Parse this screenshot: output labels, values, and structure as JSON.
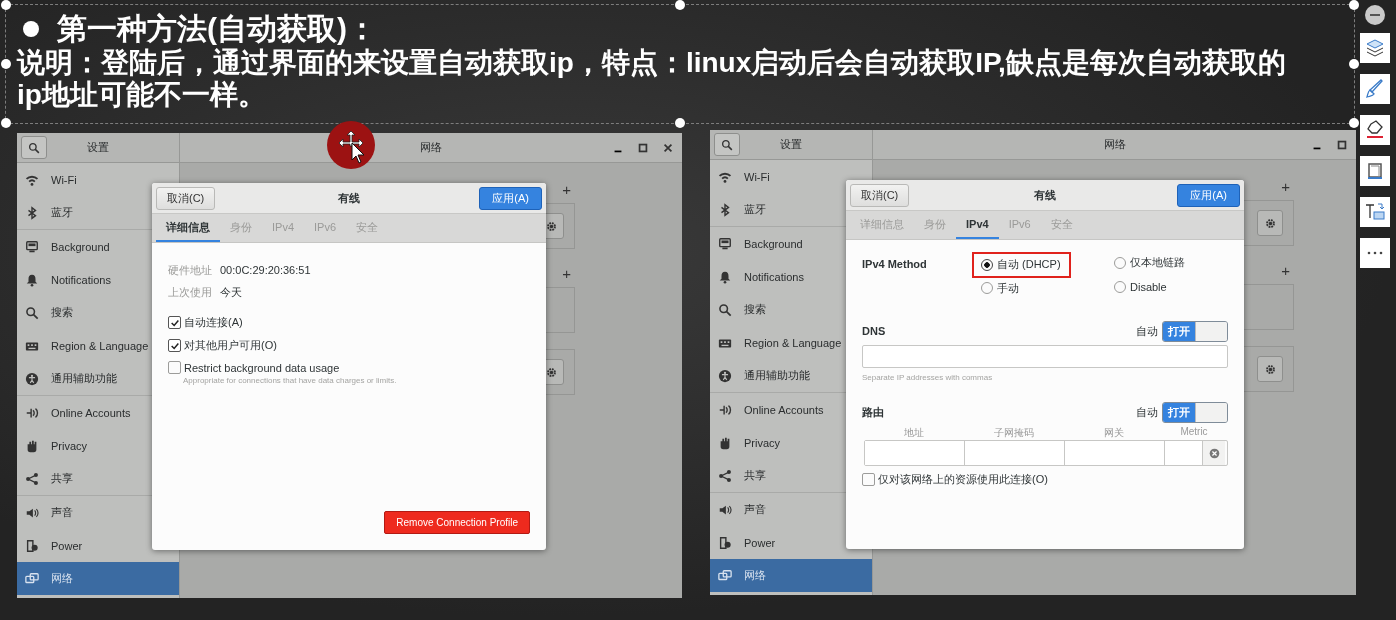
{
  "slide": {
    "title": "第一种方法(自动获取)：",
    "description": "说明：登陆后，通过界面的来设置自动获取ip，特点：linux启动后会自动获取IP,缺点是每次自动获取的ip地址可能不一样。"
  },
  "windows": [
    {
      "header": "设置",
      "page_title": "网络",
      "close_button": true,
      "add_buttons": [
        "+",
        "+"
      ],
      "sidebar": {
        "groups": [
          [
            {
              "label": "Wi-Fi",
              "selected": false
            },
            {
              "label": "蓝牙",
              "selected": false
            }
          ],
          [
            {
              "label": "Background",
              "selected": false
            },
            {
              "label": "Notifications",
              "selected": false
            },
            {
              "label": "搜索",
              "selected": false
            },
            {
              "label": "Region & Language",
              "selected": false
            },
            {
              "label": "通用辅助功能",
              "selected": false
            }
          ],
          [
            {
              "label": "Online Accounts",
              "selected": false
            },
            {
              "label": "Privacy",
              "selected": false
            },
            {
              "label": "共享",
              "selected": false
            }
          ],
          [
            {
              "label": "声音",
              "selected": false
            },
            {
              "label": "Power",
              "selected": false
            },
            {
              "label": "网络",
              "selected": true
            }
          ]
        ]
      },
      "dialog": {
        "kind": "details",
        "cancel": "取消(C)",
        "title": "有线",
        "apply": "应用(A)",
        "tabs": [
          {
            "label": "详细信息",
            "selected": true
          },
          {
            "label": "身份",
            "selected": false
          },
          {
            "label": "IPv4",
            "selected": false
          },
          {
            "label": "IPv6",
            "selected": false
          },
          {
            "label": "安全",
            "selected": false
          }
        ],
        "info": [
          {
            "label": "硬件地址",
            "value": "00:0C:29:20:36:51"
          },
          {
            "label": "上次使用",
            "value": "今天"
          }
        ],
        "options": [
          {
            "label": "自动连接(A)",
            "checked": true
          },
          {
            "label": "对其他用户可用(O)",
            "checked": true
          },
          {
            "label": "Restrict background data usage",
            "hint": "Appropriate for connections that have data charges or limits.",
            "checked": false
          }
        ],
        "remove": "Remove Connection Profile"
      }
    },
    {
      "header": "设置",
      "page_title": "网络",
      "close_button": false,
      "add_buttons": [
        "+",
        "+"
      ],
      "sidebar": {
        "groups": [
          [
            {
              "label": "Wi-Fi",
              "selected": false
            },
            {
              "label": "蓝牙",
              "selected": false
            }
          ],
          [
            {
              "label": "Background",
              "selected": false
            },
            {
              "label": "Notifications",
              "selected": false
            },
            {
              "label": "搜索",
              "selected": false
            },
            {
              "label": "Region & Language",
              "selected": false
            },
            {
              "label": "通用辅助功能",
              "selected": false
            }
          ],
          [
            {
              "label": "Online Accounts",
              "selected": false
            },
            {
              "label": "Privacy",
              "selected": false
            },
            {
              "label": "共享",
              "selected": false
            }
          ],
          [
            {
              "label": "声音",
              "selected": false
            },
            {
              "label": "Power",
              "selected": false
            },
            {
              "label": "网络",
              "selected": true
            }
          ]
        ]
      },
      "dialog": {
        "kind": "ipv4",
        "cancel": "取消(C)",
        "title": "有线",
        "apply": "应用(A)",
        "tabs": [
          {
            "label": "详细信息",
            "selected": false
          },
          {
            "label": "身份",
            "selected": false
          },
          {
            "label": "IPv4",
            "selected": true
          },
          {
            "label": "IPv6",
            "selected": false
          },
          {
            "label": "安全",
            "selected": false
          }
        ],
        "method_label": "IPv4 Method",
        "methods": [
          {
            "label": "自动 (DHCP)",
            "selected": true,
            "highlighted": true
          },
          {
            "label": "仅本地链路",
            "selected": false,
            "highlighted": false
          },
          {
            "label": "手动",
            "selected": false,
            "highlighted": false
          },
          {
            "label": "Disable",
            "selected": false,
            "highlighted": false
          }
        ],
        "dns": {
          "label": "DNS",
          "auto_label": "自动",
          "switch_text": "打开",
          "on": true,
          "hint": "Separate IP addresses with commas"
        },
        "routes": {
          "label": "路由",
          "auto_label": "自动",
          "switch_text": "打开",
          "on": true,
          "columns": [
            "地址",
            "子网掩码",
            "网关",
            "Metric"
          ],
          "option": {
            "label": "仅对该网络上的资源使用此连接(O)",
            "checked": false
          }
        }
      }
    }
  ]
}
